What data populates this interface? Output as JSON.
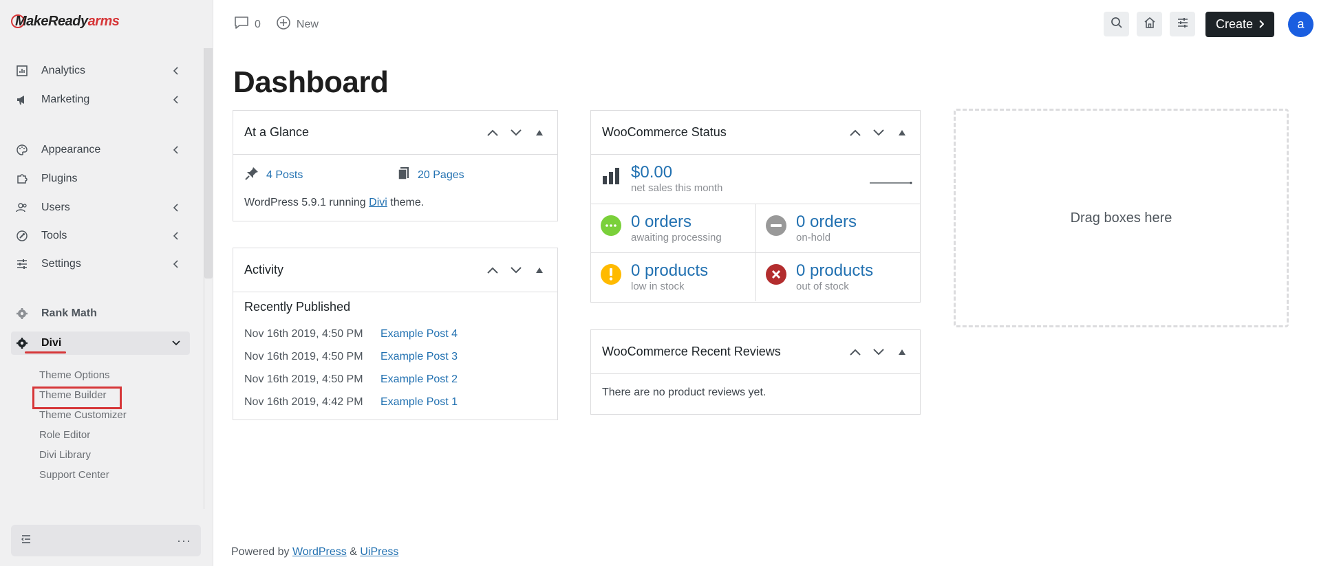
{
  "sidebar": {
    "logo": {
      "prefix": "Make",
      "mid": "Ready",
      "suffix": "arms"
    },
    "items": [
      {
        "label": "Analytics"
      },
      {
        "label": "Marketing"
      },
      {
        "label": "Appearance"
      },
      {
        "label": "Plugins"
      },
      {
        "label": "Users"
      },
      {
        "label": "Tools"
      },
      {
        "label": "Settings"
      },
      {
        "label": "Rank Math"
      },
      {
        "label": "Divi"
      }
    ],
    "divi_submenu": [
      "Theme Options",
      "Theme Builder",
      "Theme Customizer",
      "Role Editor",
      "Divi Library",
      "Support Center"
    ],
    "bottom_dots": "···"
  },
  "topbar": {
    "comments_count": "0",
    "new_label": "New",
    "create_label": "Create",
    "avatar_letter": "a"
  },
  "page_title": "Dashboard",
  "glance": {
    "title": "At a Glance",
    "posts": "4 Posts",
    "pages": "20 Pages",
    "meta_prefix": "WordPress 5.9.1 running ",
    "theme_link": "Divi",
    "meta_suffix": " theme."
  },
  "activity": {
    "title": "Activity",
    "subtitle": "Recently Published",
    "rows": [
      {
        "date": "Nov 16th 2019, 4:50 PM",
        "post": "Example Post 4"
      },
      {
        "date": "Nov 16th 2019, 4:50 PM",
        "post": "Example Post 3"
      },
      {
        "date": "Nov 16th 2019, 4:50 PM",
        "post": "Example Post 2"
      },
      {
        "date": "Nov 16th 2019, 4:42 PM",
        "post": "Example Post 1"
      }
    ]
  },
  "woo_status": {
    "title": "WooCommerce Status",
    "net_sales": {
      "value": "$0.00",
      "label": "net sales this month"
    },
    "processing": {
      "value": "0 orders",
      "label": "awaiting processing"
    },
    "on_hold": {
      "value": "0 orders",
      "label": "on-hold"
    },
    "low_stock": {
      "value": "0 products",
      "label": "low in stock"
    },
    "out_stock": {
      "value": "0 products",
      "label": "out of stock"
    }
  },
  "woo_reviews": {
    "title": "WooCommerce Recent Reviews",
    "empty": "There are no product reviews yet."
  },
  "drop_zone": "Drag boxes here",
  "footer": {
    "prefix": "Powered by ",
    "link1": "WordPress",
    "amp": " & ",
    "link2": "UiPress"
  },
  "colors": {
    "accent": "#d63638",
    "link": "#2271b1",
    "avatar": "#1a5ee0",
    "create_button": "#1d2327",
    "status_green": "#7ad03a",
    "status_gray": "#999999",
    "status_yellow": "#ffba00",
    "status_red": "#b32d2e"
  }
}
